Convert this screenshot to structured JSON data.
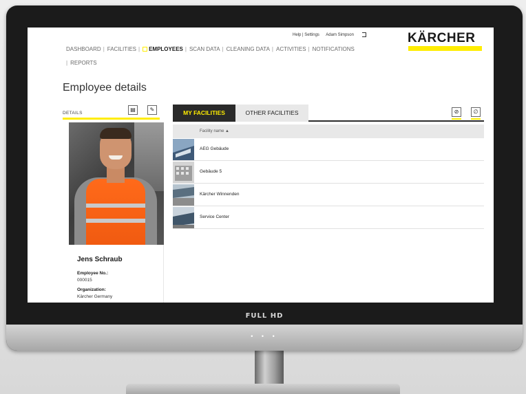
{
  "monitor": {
    "brand_label": "FULL HD",
    "chin_indicator": "• • •"
  },
  "header": {
    "util_links": [
      "Help | Settings",
      "Adam Simpson"
    ],
    "logo_text": "KÄRCHER",
    "logo_bar_color": "#ffed00"
  },
  "nav": {
    "items": [
      {
        "label": "DASHBOARD"
      },
      {
        "label": "FACILITIES"
      },
      {
        "label": "EMPLOYEES"
      },
      {
        "label": "SCAN DATA"
      },
      {
        "label": "CLEANING DATA"
      },
      {
        "label": "ACTIVITIES"
      },
      {
        "label": "NOTIFICATIONS"
      },
      {
        "label": "REPORTS"
      }
    ],
    "active": "EMPLOYEES",
    "separator": "|"
  },
  "page": {
    "title": "Employee details"
  },
  "details": {
    "label": "DETAILS",
    "save_icon": "save-icon",
    "edit_icon": "pencil-icon",
    "employee_name": "Jens Schraub",
    "employee_no_label": "Employee No.:",
    "employee_no": "000015",
    "organization_label": "Organization:",
    "organization": "Kärcher Germany"
  },
  "tabs": [
    {
      "label": "MY FACILITIES"
    },
    {
      "label": "OTHER FACILITIES"
    }
  ],
  "toolbar": {
    "icons": [
      "unlink-icon",
      "link-icon"
    ]
  },
  "table": {
    "column_header": "Facility name ▲",
    "rows": [
      {
        "name": "AEG Gebäude"
      },
      {
        "name": "Gebäude 5"
      },
      {
        "name": "Kärcher Winnenden"
      },
      {
        "name": "Service Center"
      }
    ]
  },
  "colors": {
    "accent": "#ffed00",
    "tab_active_bg": "#2a2a2a",
    "tab_inactive_bg": "#e8e8e8",
    "vest": "#f05a10"
  }
}
